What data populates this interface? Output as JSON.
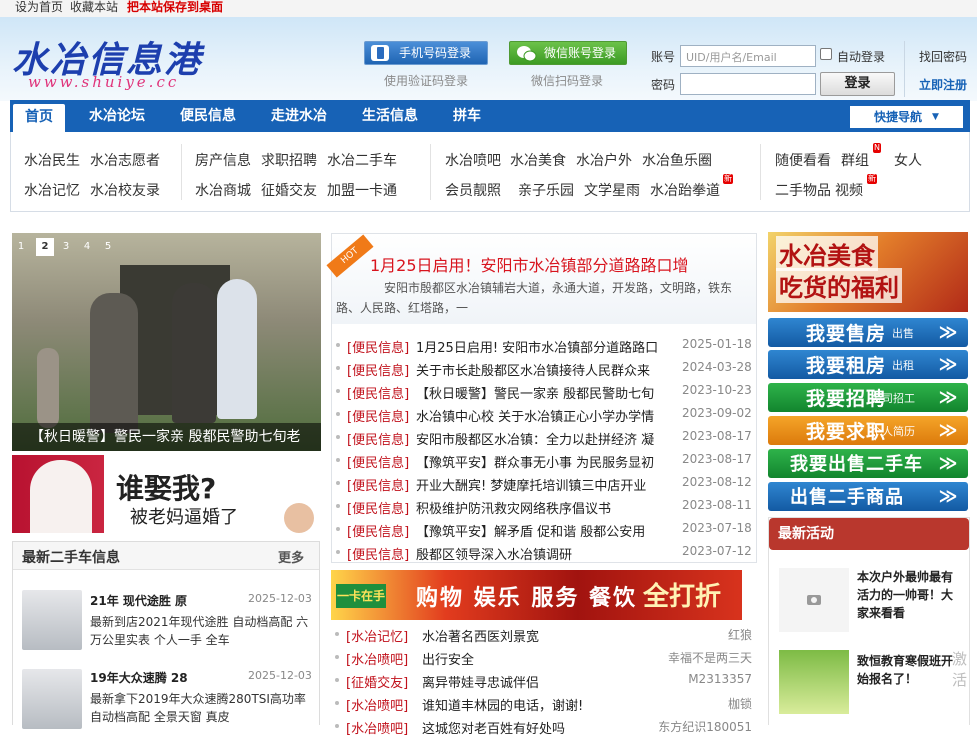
{
  "topbar": {
    "set_home": "设为首页",
    "bookmark": "收藏本站",
    "save_desktop": "把本站保存到桌面"
  },
  "logo": {
    "cn": "水冶信息港",
    "en": "www.shuiye.cc"
  },
  "login": {
    "phone_btn": "手机号码登录",
    "phone_sub": "使用验证码登录",
    "wechat_btn": "微信账号登录",
    "wechat_sub": "微信扫码登录",
    "account_label": "账号",
    "account_placeholder": "UID/用户名/Email",
    "auto_login": "自动登录",
    "password_label": "密码",
    "submit": "登录",
    "forgot": "找回密码",
    "register": "立即注册"
  },
  "nav": {
    "items": [
      "首页",
      "水冶论坛",
      "便民信息",
      "走进水冶",
      "生活信息",
      "拼车"
    ],
    "quick": "快捷导航"
  },
  "subnav": {
    "group1": [
      "水冶民生",
      "水冶志愿者",
      "水冶记忆",
      "水冶校友录"
    ],
    "group2": [
      "房产信息",
      "求职招聘",
      "水冶二手车",
      "水冶商城",
      "征婚交友",
      "加盟一卡通"
    ],
    "group3": [
      "水冶喷吧",
      "水冶美食",
      "水冶户外",
      "水冶鱼乐圈",
      "会员靓照",
      "亲子乐园",
      "文学星雨",
      "水冶跆拳道"
    ],
    "group4": [
      "随便看看",
      "群组",
      "女人",
      "二手物品",
      "视频"
    ],
    "badge_n": "N",
    "badge_new": "新"
  },
  "carousel": {
    "pages": [
      "1",
      "2",
      "3",
      "4",
      "5"
    ],
    "active_page": 2,
    "caption": "【秋日暖警】警民一家亲  殷都民警助七旬老"
  },
  "ad_marry": {
    "line1": "谁娶我?",
    "line2": "被老妈逼婚了"
  },
  "used_cars": {
    "title": "最新二手车信息",
    "more": "更多",
    "items": [
      {
        "title": "21年  现代途胜  原",
        "date": "2025-12-03",
        "desc": "最新到店2021年现代途胜 自动档高配 六万公里实表 个人一手 全车"
      },
      {
        "title": "19年大众速腾  28",
        "date": "2025-12-03",
        "desc": "最新拿下2019年大众速腾280TSI高功率 自动档高配 全景天窗 真皮"
      }
    ]
  },
  "headline": {
    "badge": "HOT",
    "title": "1月25日启用！安阳市水冶镇部分道路路口增",
    "summary": "安阳市殷都区水冶镇辅岩大道，永通大道，开发路，文明路，铁东",
    "summary2": "路、人民路、红塔路，一"
  },
  "news_list": [
    {
      "cat": "[便民信息]",
      "title": "1月25日启用! 安阳市水冶镇部分道路路口",
      "date": "2025-01-18"
    },
    {
      "cat": "[便民信息]",
      "title": "关于市长赴殷都区水冶镇接待人民群众来",
      "date": "2024-03-28"
    },
    {
      "cat": "[便民信息]",
      "title": "【秋日暖警】警民一家亲  殷都民警助七旬",
      "date": "2023-10-23"
    },
    {
      "cat": "[便民信息]",
      "title": "水冶镇中心校  关于水冶镇正心小学办学情",
      "date": "2023-09-02"
    },
    {
      "cat": "[便民信息]",
      "title": "安阳市殷都区水冶镇：全力以赴拼经济  凝",
      "date": "2023-08-17"
    },
    {
      "cat": "[便民信息]",
      "title": "【豫筑平安】群众事无小事  为民服务显初",
      "date": "2023-08-17"
    },
    {
      "cat": "[便民信息]",
      "title": "开业大酬宾! 梦婕摩托培训镇三中店开业",
      "date": "2023-08-12"
    },
    {
      "cat": "[便民信息]",
      "title": "积极维护防汛救灾网络秩序倡议书",
      "date": "2023-08-11"
    },
    {
      "cat": "[便民信息]",
      "title": "【豫筑平安】解矛盾  促和谐  殷都公安用",
      "date": "2023-07-18"
    },
    {
      "cat": "[便民信息]",
      "title": "殷都区领导深入水冶镇调研",
      "date": "2023-07-12"
    }
  ],
  "banner2": {
    "card": "一卡在手",
    "text": "购物 娱乐 服务 餐饮",
    "discount": "全打折"
  },
  "news_list2": [
    {
      "cat": "[水冶记忆]",
      "title": "水冶著名西医刘景宽",
      "author": "红狼"
    },
    {
      "cat": "[水冶喷吧]",
      "title": "出行安全",
      "author": "幸福不是两三天"
    },
    {
      "cat": "[征婚交友]",
      "title": "离异带娃寻忠诚伴侣",
      "author": "M2313357"
    },
    {
      "cat": "[水冶喷吧]",
      "title": "谁知道丰林园的电话，谢谢!",
      "author": "枷锁"
    },
    {
      "cat": "[水冶喷吧]",
      "title": "这城您对老百姓有好处吗",
      "author": "东方纪识180051"
    }
  ],
  "food_ad": {
    "line1": "水冶美食",
    "line2": "吃货的福利"
  },
  "actions": [
    {
      "big": "我要售房",
      "small": "出售",
      "color": "blue"
    },
    {
      "big": "我要租房",
      "small": "出租",
      "color": "blue"
    },
    {
      "big": "我要招聘",
      "small": "公司招工",
      "color": "green"
    },
    {
      "big": "我要求职",
      "small": "个人简历",
      "color": "orange"
    },
    {
      "big": "我要出售二手车",
      "small": "",
      "color": "green"
    },
    {
      "big": "出售二手商品",
      "small": "",
      "color": "blue"
    }
  ],
  "events": {
    "title": "最新活动",
    "items": [
      {
        "title": "本次户外最帅最有活力的一帅哥！大家来看看"
      },
      {
        "title": "致恒教育寒假班开始报名了！"
      }
    ]
  },
  "side_ad": {
    "text": "激活"
  },
  "colors": {
    "brand": "#1762b6",
    "accent_red": "#c1121c",
    "activity_red": "#b9372d"
  }
}
